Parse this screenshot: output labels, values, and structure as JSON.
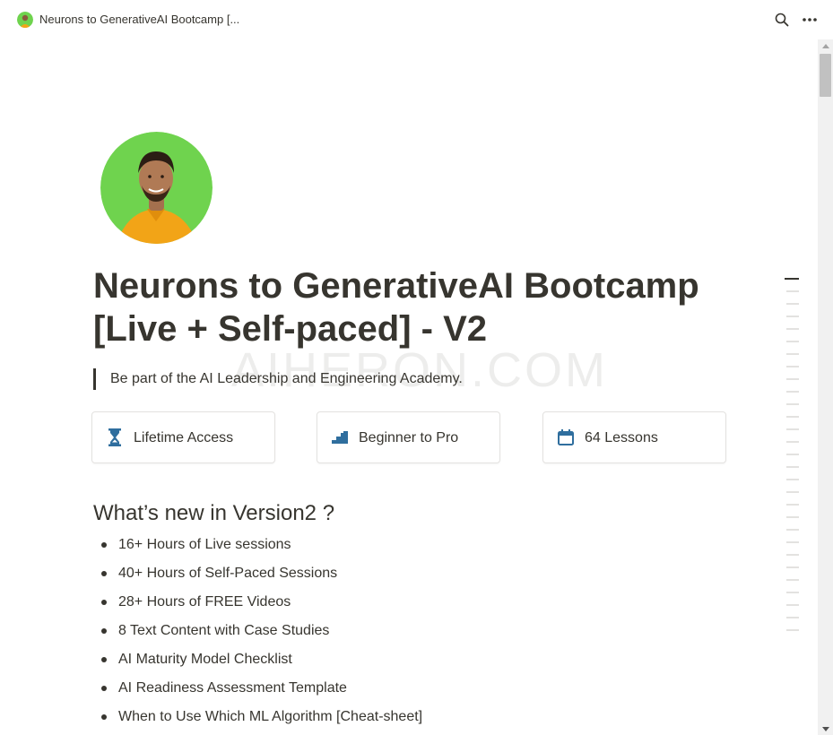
{
  "browser": {
    "tab_title": "Neurons to GenerativeAI Bootcamp [...",
    "search_icon": "search-icon",
    "more_icon": "more-horizontal-icon"
  },
  "page": {
    "title": "Neurons to GenerativeAI Bootcamp [Live + Self-paced] - V2",
    "watermark": "AIHERON.COM",
    "quote": "Be part of the AI Leadership and Engineering Academy.",
    "cards": [
      {
        "label": "Lifetime Access",
        "icon": "hourglass-icon"
      },
      {
        "label": "Beginner to Pro",
        "icon": "stairs-icon"
      },
      {
        "label": "64 Lessons",
        "icon": "calendar-icon"
      }
    ],
    "section_heading": "What’s new in Version2 ?",
    "bullets": [
      "16+ Hours of Live sessions",
      "40+ Hours of Self-Paced Sessions",
      "28+ Hours of FREE Videos",
      "8 Text Content with Case Studies",
      "AI Maturity Model Checklist",
      "AI Readiness Assessment Template",
      "When to Use Which ML Algorithm [Cheat-sheet]"
    ]
  },
  "colors": {
    "text": "#37352f",
    "icon_blue": "#2f6e9e",
    "avatar_bg": "#6fd34e",
    "shirt": "#f2a417"
  }
}
